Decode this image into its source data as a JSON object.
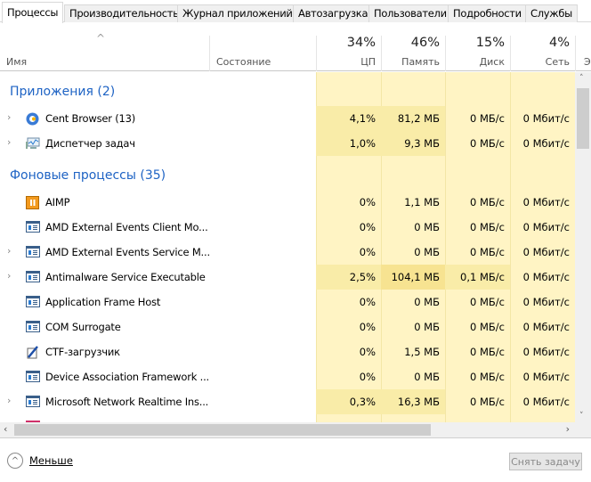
{
  "tabs": [
    "Процессы",
    "Производительность",
    "Журнал приложений",
    "Автозагрузка",
    "Пользователи",
    "Подробности",
    "Службы"
  ],
  "header": {
    "name": "Имя",
    "state": "Состояние",
    "cpu_pct": "34%",
    "cpu": "ЦП",
    "mem_pct": "46%",
    "mem": "Память",
    "disk_pct": "15%",
    "disk": "Диск",
    "net_pct": "4%",
    "net": "Сеть",
    "extra": "Э"
  },
  "groups": {
    "apps": "Приложения (2)",
    "background": "Фоновые процессы (35)"
  },
  "rows": [
    {
      "name": "Cent Browser (13)",
      "icon": "cent-browser-icon",
      "exp": true,
      "cpu": "4,1%",
      "mem": "81,2 МБ",
      "disk": "0 МБ/с",
      "net": "0 Мбит/с",
      "hi": [
        1,
        1,
        0,
        0
      ]
    },
    {
      "name": "Диспетчер задач",
      "icon": "task-manager-icon",
      "exp": true,
      "cpu": "1,0%",
      "mem": "9,3 МБ",
      "disk": "0 МБ/с",
      "net": "0 Мбит/с",
      "hi": [
        1,
        1,
        0,
        0
      ]
    },
    {
      "name": "AIMP",
      "icon": "aimp-icon",
      "exp": false,
      "cpu": "0%",
      "mem": "1,1 МБ",
      "disk": "0 МБ/с",
      "net": "0 Мбит/с",
      "hi": [
        0,
        0,
        0,
        0
      ]
    },
    {
      "name": "AMD External Events Client Mo...",
      "icon": "service-icon",
      "exp": false,
      "cpu": "0%",
      "mem": "0 МБ",
      "disk": "0 МБ/с",
      "net": "0 Мбит/с",
      "hi": [
        0,
        0,
        0,
        0
      ]
    },
    {
      "name": "AMD External Events Service M...",
      "icon": "service-icon",
      "exp": true,
      "cpu": "0%",
      "mem": "0 МБ",
      "disk": "0 МБ/с",
      "net": "0 Мбит/с",
      "hi": [
        0,
        0,
        0,
        0
      ]
    },
    {
      "name": "Antimalware Service Executable",
      "icon": "service-icon",
      "exp": true,
      "cpu": "2,5%",
      "mem": "104,1 МБ",
      "disk": "0,1 МБ/с",
      "net": "0 Мбит/с",
      "hi": [
        1,
        2,
        1,
        0
      ]
    },
    {
      "name": "Application Frame Host",
      "icon": "service-icon",
      "exp": false,
      "cpu": "0%",
      "mem": "0 МБ",
      "disk": "0 МБ/с",
      "net": "0 Мбит/с",
      "hi": [
        0,
        0,
        0,
        0
      ]
    },
    {
      "name": "COM Surrogate",
      "icon": "service-icon",
      "exp": false,
      "cpu": "0%",
      "mem": "0 МБ",
      "disk": "0 МБ/с",
      "net": "0 Мбит/с",
      "hi": [
        0,
        0,
        0,
        0
      ]
    },
    {
      "name": "CTF-загрузчик",
      "icon": "ctf-icon",
      "exp": false,
      "cpu": "0%",
      "mem": "1,5 МБ",
      "disk": "0 МБ/с",
      "net": "0 Мбит/с",
      "hi": [
        0,
        0,
        0,
        0
      ]
    },
    {
      "name": "Device Association Framework ...",
      "icon": "service-icon",
      "exp": false,
      "cpu": "0%",
      "mem": "0 МБ",
      "disk": "0 МБ/с",
      "net": "0 Мбит/с",
      "hi": [
        0,
        0,
        0,
        0
      ]
    },
    {
      "name": "Microsoft Network Realtime Ins...",
      "icon": "service-icon",
      "exp": true,
      "cpu": "0,3%",
      "mem": "16,3 МБ",
      "disk": "0 МБ/с",
      "net": "0 Мбит/с",
      "hi": [
        1,
        1,
        0,
        0
      ]
    }
  ],
  "footer": {
    "less": "Меньше",
    "end_task": "Снять задачу"
  }
}
